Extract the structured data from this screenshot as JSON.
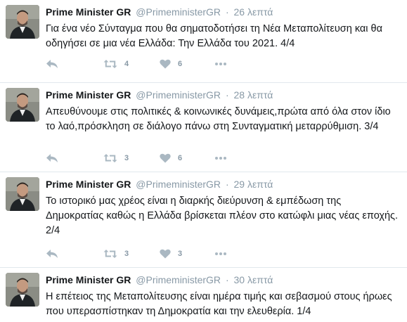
{
  "tweets": [
    {
      "fullname": "Prime Minister GR",
      "username": "@PrimeministerGR",
      "separator": "·",
      "time": "26 λεπτά",
      "text": "Για ένα νέο Σύνταγμα που θα σηματοδοτήσει τη Νέα Μεταπολίτευση και θα οδηγήσει σε μια νέα Ελλάδα: Την Ελλάδα του 2021.  4/4",
      "retweets": "4",
      "likes": "6"
    },
    {
      "fullname": "Prime Minister GR",
      "username": "@PrimeministerGR",
      "separator": "·",
      "time": "28 λεπτά",
      "text": "Απευθύνουμε στις πολιτικές & κοινωνικές δυνάμεις,πρώτα από όλα στον ίδιο το λαό,πρόσκληση σε διάλογο πάνω στη Συνταγματική μεταρρύθμιση. 3/4",
      "retweets": "3",
      "likes": "6"
    },
    {
      "fullname": "Prime Minister GR",
      "username": "@PrimeministerGR",
      "separator": "·",
      "time": "29 λεπτά",
      "text": "Το ιστορικό μας χρέος είναι η διαρκής διεύρυνση & εμπέδωση της Δημοκρατίας καθώς η Ελλάδα βρίσκεται πλέον στο κατώφλι μιας νέας εποχής. 2/4",
      "retweets": "3",
      "likes": "3"
    },
    {
      "fullname": "Prime Minister GR",
      "username": "@PrimeministerGR",
      "separator": "·",
      "time": "30 λεπτά",
      "text": "Η επέτειος της Μεταπολίτευσης είναι ημέρα τιμής και σεβασμού στους ήρωες που υπερασπίστηκαν τη Δημοκρατία και την ελευθερία.  1/4",
      "retweets": "",
      "likes": ""
    }
  ],
  "icons": {
    "reply": "reply-icon",
    "retweet": "retweet-icon",
    "like": "heart-icon",
    "more": "more-dots-icon"
  },
  "colors": {
    "action_icon": "#aab8c2",
    "secondary_text": "#8899a6",
    "primary_text": "#14171a",
    "divider": "#e1e8ed"
  }
}
